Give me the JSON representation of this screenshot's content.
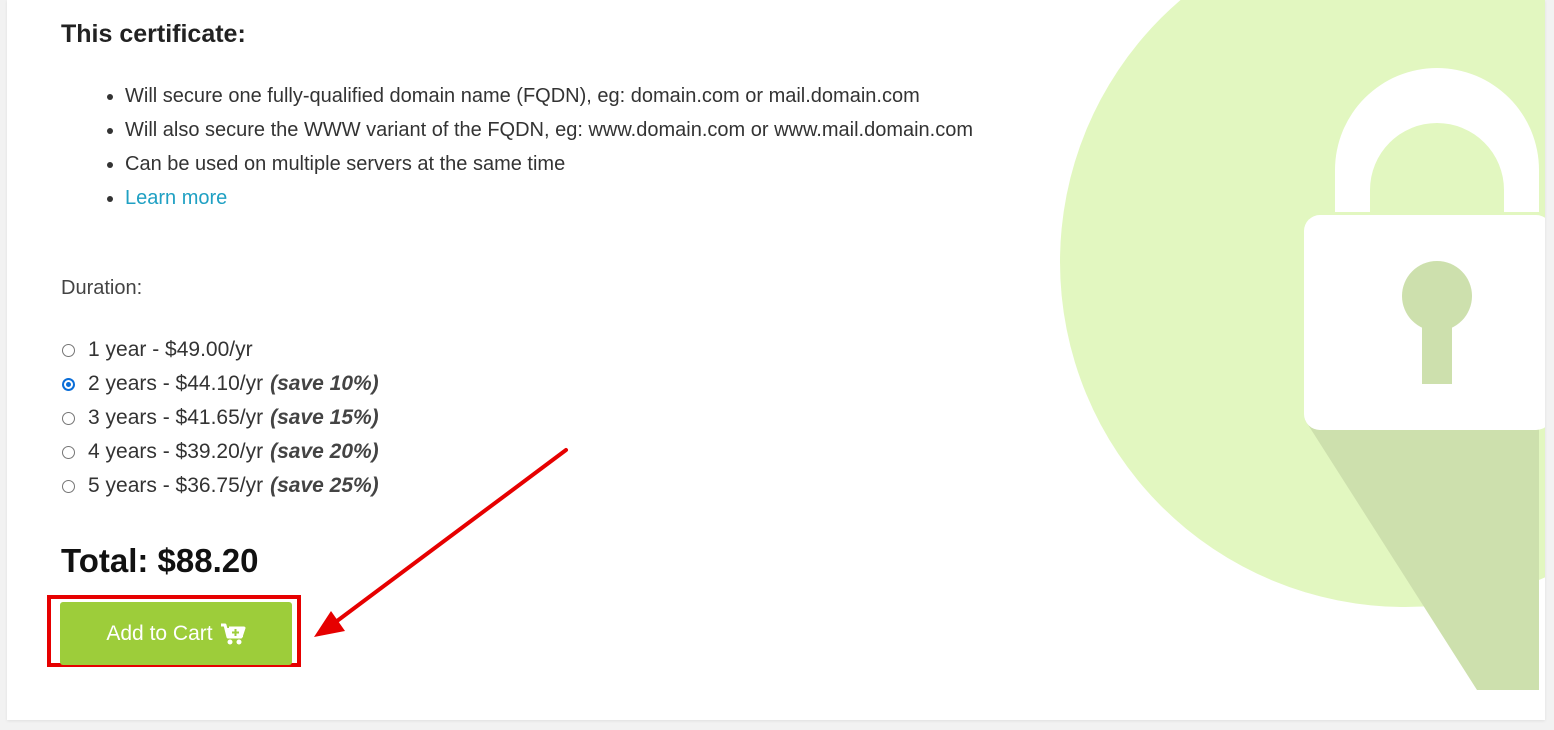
{
  "certificate": {
    "heading": "This certificate:",
    "features": [
      "Will secure one fully-qualified domain name (FQDN), eg: domain.com or mail.domain.com",
      "Will also secure the WWW variant of the FQDN, eg: www.domain.com or www.mail.domain.com",
      "Can be used on multiple servers at the same time"
    ],
    "learn_more": "Learn more"
  },
  "duration": {
    "label": "Duration:",
    "options": [
      {
        "text": "1 year - $49.00/yr",
        "save": "",
        "selected": false
      },
      {
        "text": "2 years - $44.10/yr",
        "save": "(save 10%)",
        "selected": true
      },
      {
        "text": "3 years - $41.65/yr",
        "save": "(save 15%)",
        "selected": false
      },
      {
        "text": "4 years - $39.20/yr",
        "save": "(save 20%)",
        "selected": false
      },
      {
        "text": "5 years - $36.75/yr",
        "save": "(save 25%)",
        "selected": false
      }
    ]
  },
  "total": "Total: $88.20",
  "cart_button": {
    "label": "Add to Cart",
    "icon": "cart-plus-icon"
  },
  "annotations": {
    "highlight_color": "#e60000",
    "arrow_color": "#e60000"
  },
  "colors": {
    "accent_green": "#9dcd3a",
    "link": "#1fa0c3",
    "lock_circle": "#e2f7c0",
    "lock_shadow": "#cde0ad",
    "radio_checked": "#0b6ed8"
  }
}
